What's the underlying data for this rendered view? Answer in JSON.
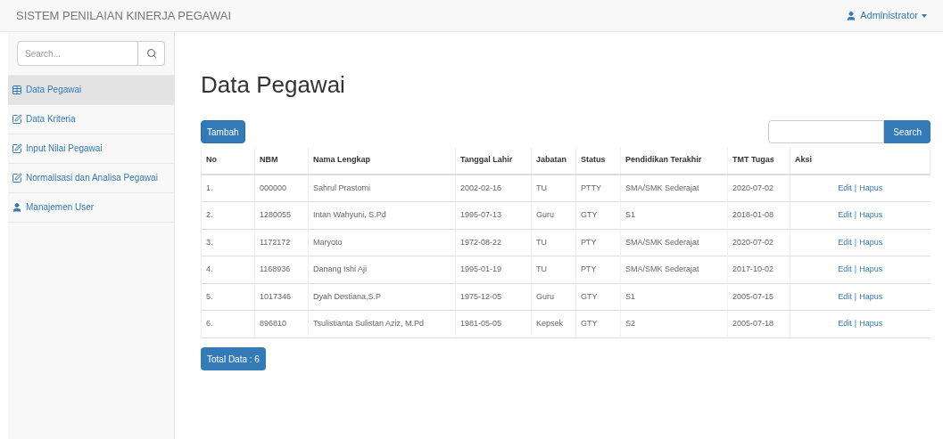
{
  "navbar": {
    "brand": "SISTEM PENILAIAN KINERJA PEGAWAI",
    "user": {
      "label": "Administrator"
    }
  },
  "sidebar": {
    "search": {
      "placeholder": "Search..."
    },
    "items": [
      {
        "label": "Data Pegawai",
        "kind": "table",
        "selected": true
      },
      {
        "label": "Data Kriteria",
        "kind": "edit",
        "selected": false
      },
      {
        "label": "Input Nilai Pegawai",
        "kind": "edit",
        "selected": false
      },
      {
        "label": "Normalisasi dan Analisa Pegawai",
        "kind": "edit",
        "selected": false
      },
      {
        "label": "Manajemen User",
        "kind": "user",
        "selected": false
      }
    ]
  },
  "page": {
    "title": "Data Pegawai",
    "add_button": "Tambah",
    "search_button": "Search",
    "table": {
      "columns": [
        "No",
        "NBM",
        "Nama Lengkap",
        "Tanggal Lahir",
        "Jabatan",
        "Status",
        "Pendidikan Terakhir",
        "TMT Tugas",
        "Aksi"
      ],
      "rows": [
        {
          "cells": [
            "1.",
            "000000",
            "Sahrul Prastomi",
            "2002-02-16",
            "TU",
            "PTTY",
            "SMA/SMK Sederajat",
            "2020-07-02"
          ],
          "actions": {
            "edit": "Edit",
            "separator": "|",
            "delete": "Hapus"
          }
        },
        {
          "cells": [
            "2.",
            "1280055",
            "Intan Wahyuni, S.Pd",
            "1995-07-13",
            "Guru",
            "GTY",
            "S1",
            "2018-01-08"
          ],
          "actions": {
            "edit": "Edit",
            "separator": "|",
            "delete": "Hapus"
          }
        },
        {
          "cells": [
            "3.",
            "1172172",
            "Maryoto",
            "1972-08-22",
            "TU",
            "PTY",
            "SMA/SMK Sederajat",
            "2020-07-02"
          ],
          "actions": {
            "edit": "Edit",
            "separator": "|",
            "delete": "Hapus"
          }
        },
        {
          "cells": [
            "4.",
            "1168936",
            "Danang Ishi Aji",
            "1995-01-19",
            "TU",
            "PTY",
            "SMA/SMK Sederajat",
            "2017-10-02"
          ],
          "actions": {
            "edit": "Edit",
            "separator": "|",
            "delete": "Hapus"
          }
        },
        {
          "cells": [
            "5.",
            "1017346",
            "Dyah Destiana,S.P",
            "1975-12-05",
            "Guru",
            "GTY",
            "S1",
            "2005-07-15"
          ],
          "actions": {
            "edit": "Edit",
            "separator": "|",
            "delete": "Hapus"
          }
        },
        {
          "cells": [
            "6.",
            "896810",
            "Tsulistianta Sulistan Aziz, M.Pd",
            "1981-05-05",
            "Kepsek",
            "GTY",
            "S2",
            "2005-07-18"
          ],
          "actions": {
            "edit": "Edit",
            "separator": "|",
            "delete": "Hapus"
          }
        }
      ]
    },
    "total_button": "Total Data : 6"
  }
}
